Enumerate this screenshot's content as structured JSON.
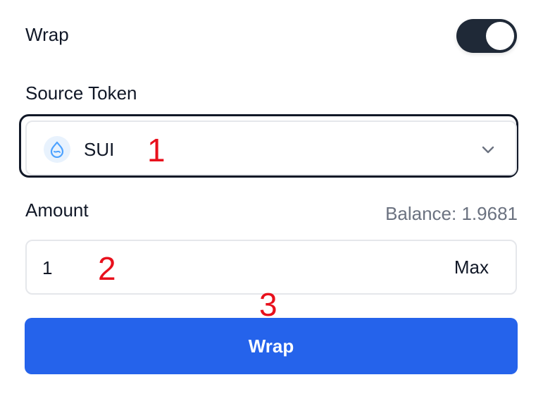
{
  "wrap_toggle": {
    "label": "Wrap",
    "state": "on"
  },
  "source_token": {
    "label": "Source Token",
    "selected": "SUI",
    "icon": "sui-droplet-icon"
  },
  "amount": {
    "label": "Amount",
    "balance_text": "Balance: 1.9681",
    "value": "1",
    "max_label": "Max"
  },
  "action": {
    "button_label": "Wrap"
  },
  "annotations": [
    "1",
    "2",
    "3"
  ],
  "colors": {
    "primary": "#2563eb",
    "toggle_on": "#1f2937",
    "annotation": "#e8101c",
    "muted_text": "#6b7280",
    "token_icon": "#4da2ff"
  }
}
